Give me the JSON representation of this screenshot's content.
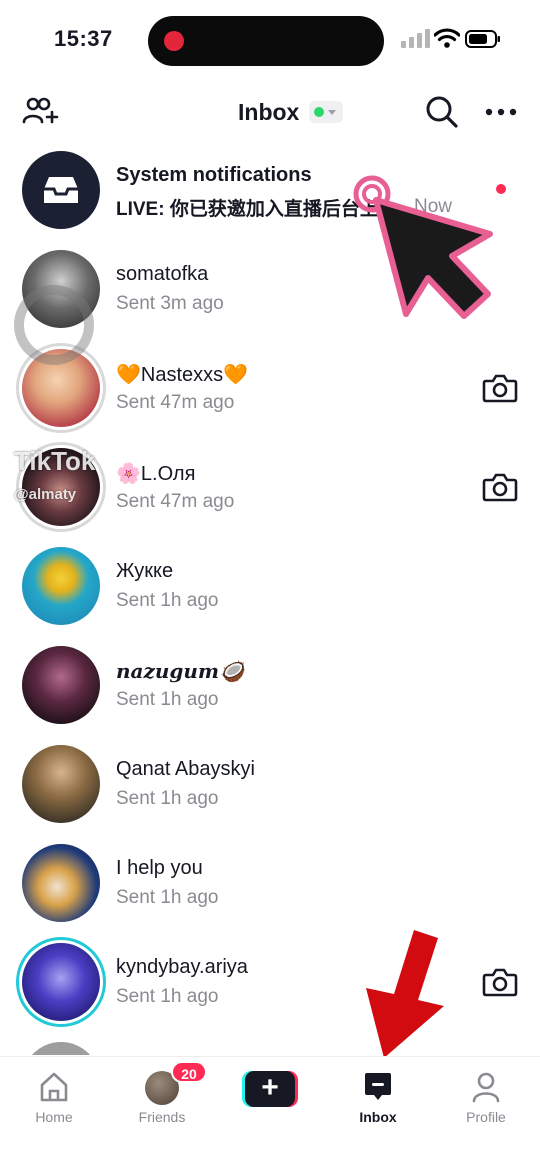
{
  "status_bar": {
    "time": "15:37"
  },
  "header": {
    "title": "Inbox"
  },
  "conversations": [
    {
      "name": "System notifications",
      "subtitle": "LIVE: 你已获邀加入直播后台上",
      "time": "Now",
      "unread": true
    },
    {
      "name": "somatofka",
      "subtitle": "Sent 3m ago"
    },
    {
      "name": "🧡Nastexxs🧡",
      "subtitle": "Sent 47m ago"
    },
    {
      "name": "🌸L.Оля",
      "subtitle": "Sent 47m ago"
    },
    {
      "name": "Жукке",
      "subtitle": "Sent 1h ago"
    },
    {
      "name": "nazugum🥥",
      "subtitle": "Sent 1h ago"
    },
    {
      "name": "Qanat Abayskyi",
      "subtitle": "Sent 1h ago"
    },
    {
      "name": "I help you",
      "subtitle": "Sent 1h ago"
    },
    {
      "name": "kyndybay.ariya",
      "subtitle": "Sent 1h ago"
    }
  ],
  "watermark": {
    "brand": "TikTok",
    "handle": "@almaty"
  },
  "bottom_nav": {
    "home": "Home",
    "friends": "Friends",
    "friends_badge": "20",
    "inbox": "Inbox",
    "profile": "Profile"
  },
  "colors": {
    "accent": "#fe2c55",
    "teal": "#25f4ee",
    "online": "#2bd66a",
    "text": "#161823",
    "muted": "#8a8b91"
  }
}
